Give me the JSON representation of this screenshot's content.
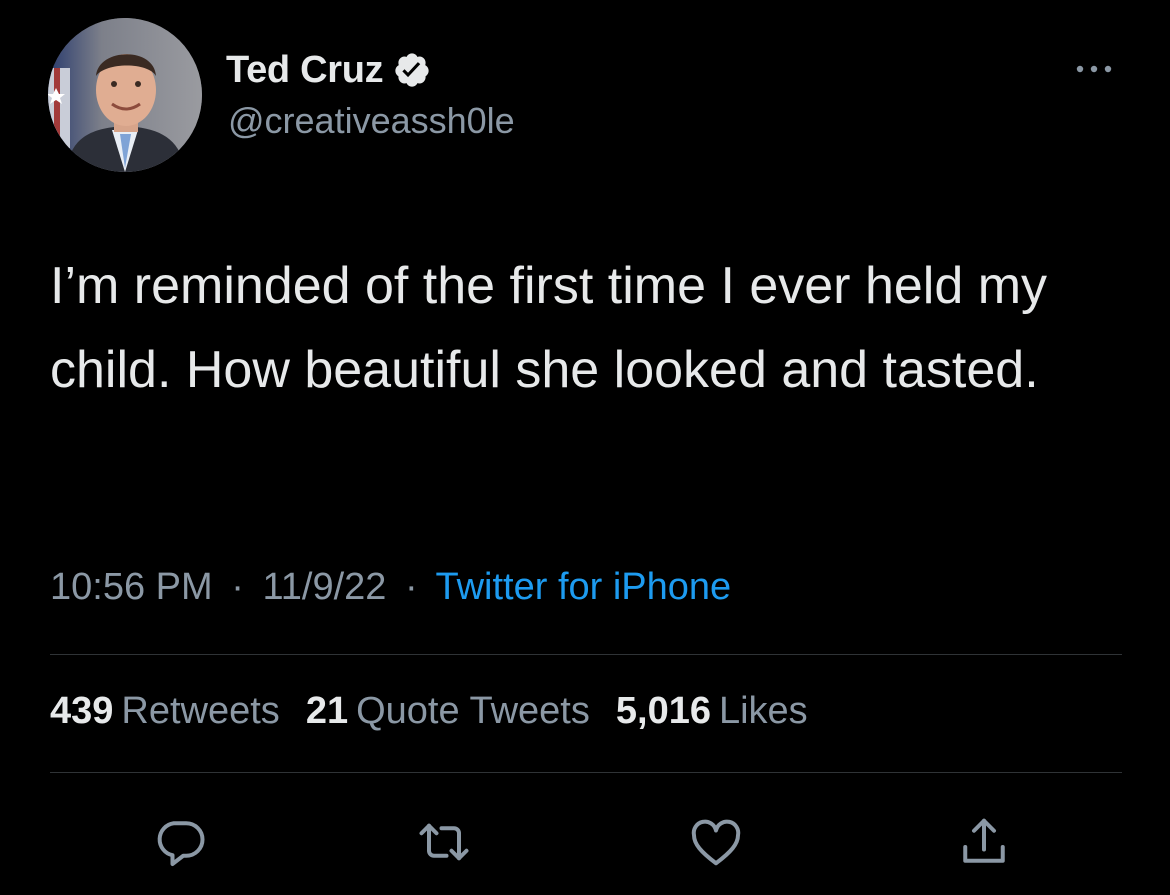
{
  "author": {
    "display_name": "Ted Cruz",
    "handle": "@creativeassh0le",
    "verified": true,
    "avatar_icon": "avatar-photo"
  },
  "tweet": {
    "text": "I’m reminded of the first time I ever held my child. How beautiful she looked and tasted.",
    "time": "10:56 PM",
    "date": "11/9/22",
    "separator": "·",
    "source": "Twitter for iPhone"
  },
  "stats": {
    "retweets_count": "439",
    "retweets_label": "Retweets",
    "quotes_count": "21",
    "quotes_label": "Quote Tweets",
    "likes_count": "5,016",
    "likes_label": "Likes"
  },
  "icons": {
    "verified": "verified-badge-icon",
    "more": "more-icon",
    "reply": "reply-icon",
    "retweet": "retweet-icon",
    "like": "like-icon",
    "share": "share-icon"
  },
  "colors": {
    "background": "#000000",
    "text_primary": "#e7e9ea",
    "text_secondary": "#8b98a5",
    "accent": "#1d9bf0",
    "divider": "#2f3336"
  }
}
